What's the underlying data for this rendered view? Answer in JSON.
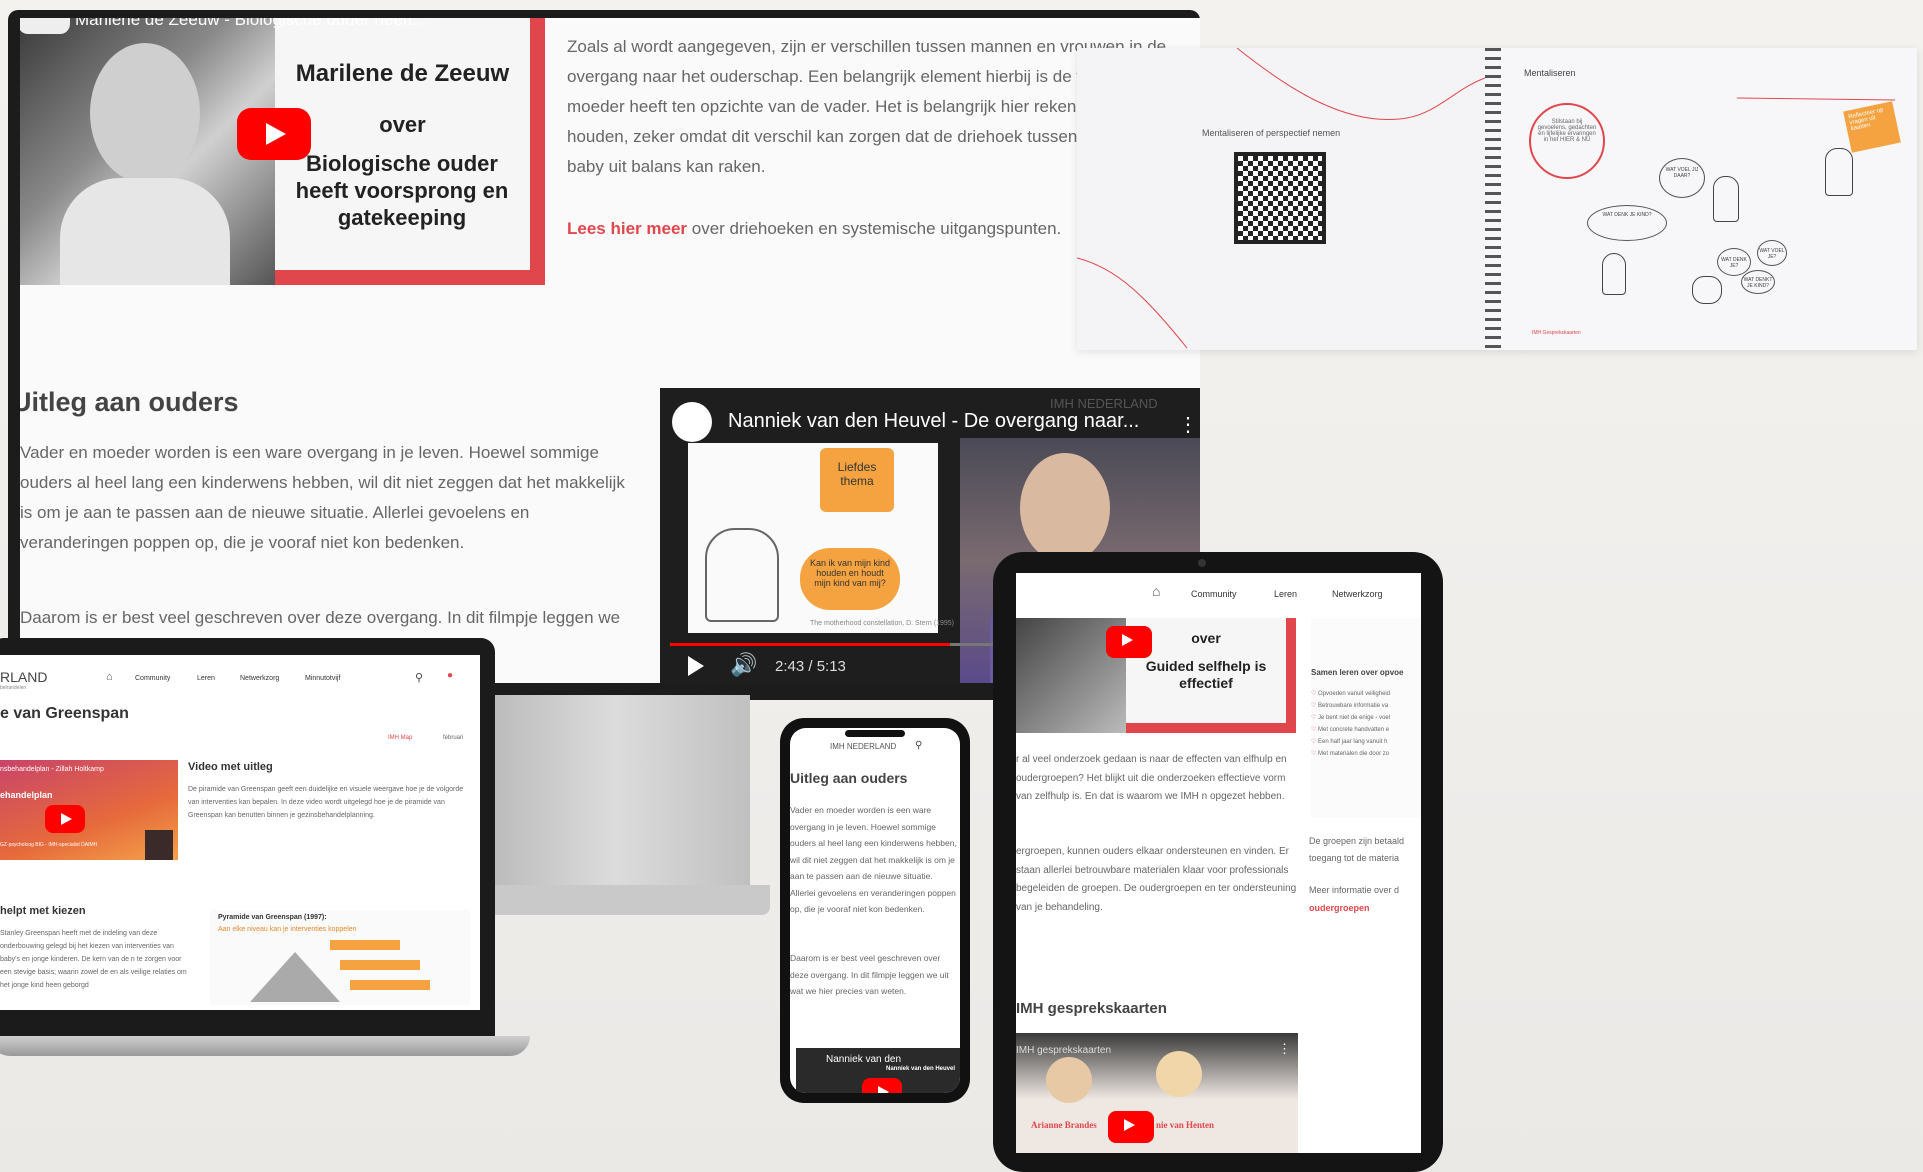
{
  "monitor": {
    "video1": {
      "title_bar": "Marilene de Zeeuw - Biologische ouder heeft...",
      "name": "Marilene de Zeeuw",
      "over": "over",
      "topic": "Biologische ouder heeft voorsprong en gatekeeping"
    },
    "para1": "Zoals al wordt aangegeven, zijn er verschillen tussen mannen en vrouwen in de overgang naar het ouderschap. Een belangrijk element hierbij is de voorsprong die de moeder heeft ten opzichte van de vader. Het is belangrijk hier rekening mee te houden, zeker omdat dit verschil kan zorgen dat de driehoek tussen vader, moeder en baby uit balans kan raken.",
    "link_text": "Lees hier meer",
    "link_rest": "over driehoeken en systemische uitgangspunten.",
    "section_heading": "Uitleg aan ouders",
    "para2": "Vader en moeder worden is een ware overgang in je leven. Hoewel sommige ouders al heel lang een kinderwens hebben, wil dit niet zeggen dat het makkelijk is om je aan te passen aan de nieuwe situatie. Allerlei gevoelens en veranderingen poppen op, die je vooraf niet kon bedenken.",
    "para3": "Daarom is er best veel geschreven over deze overgang. In dit filmpje leggen we uit wat we hier precies van weten.",
    "video2": {
      "title": "Nanniek van den Heuvel - De overgang naar...",
      "brand": "IMH NEDERLAND",
      "bubble1": "Liefdes thema",
      "bubble2": "Kan ik van mijn kind houden en houdt mijn kind van mij?",
      "caption": "The motherhood constellation, D. Stern (1995)",
      "time": "2:43 / 5:13"
    }
  },
  "notebook": {
    "left_label": "Mentaliseren of perspectief nemen",
    "right_label": "Mentaliseren",
    "circle_text": "Stilstaan bij gevoelens, gedachten en lijfelijke ervaringen in het HIER & NU",
    "sticky_text": "Reflecteer op vragen uit kaarten",
    "bubbles": [
      "WAT VOEL JIJ DAAR?",
      "WAT DENK JE KIND?",
      "WAT VOELT JE KIND?",
      "WAT DENK JE?",
      "WAT VOEL JE?",
      "WAT DENKT JE KIND?"
    ],
    "footer": "IMH Gesprekskaarten"
  },
  "laptop": {
    "brand": "RLAND",
    "brand_sub": "behandelen",
    "nav": [
      "Community",
      "Leren",
      "Netwerkzorg",
      "Minnutotvijf"
    ],
    "title": "e van Greenspan",
    "meta1": "IMH Map",
    "meta2": "februari",
    "video_title": "nsbehandelplan - Zillah Holtkamp",
    "video_overlay": "ehandelplan",
    "video_sub": "GZ-psycholoog BIG - IMH-specialist DAIMH",
    "side_heading": "Video met uitleg",
    "side_text": "De piramide van Greenspan geeft een duidelijke en visuele weergave hoe je de volgorde van interventies kan bepalen. In deze video wordt uitgelegd hoe je de piramide van Greenspan kan benutten binnen je gezinsbehandelplanning.",
    "heading2": "helpt met kiezen",
    "text2": "Stanley Greenspan heeft met de indeling van deze onderbouwing gelegd bij het kiezen van interventies van baby's en jonge kinderen. De kern van de n te zorgen voor een stevige basis; waarin zowel de en als veilige relaties om het jonge kind heen geborgd",
    "pyr_title": "Pyramide van Greenspan (1997):",
    "pyr_sub": "Aan elke niveau kan je interventies koppelen"
  },
  "phone": {
    "brand": "IMH NEDERLAND",
    "heading": "Uitleg aan ouders",
    "para1": "Vader en moeder worden is een ware overgang in je leven. Hoewel sommige ouders al heel lang een kinderwens hebben, wil dit niet zeggen dat het makkelijk is om je aan te passen aan de nieuwe situatie. Allerlei gevoelens en veranderingen poppen op, die je vooraf niet kon bedenken.",
    "para2": "Daarom is er best veel geschreven over deze overgang. In dit filmpje leggen we uit wat we hier precies van weten.",
    "video_title": "Nanniek van den",
    "video_name": "Nanniek van den Heuvel"
  },
  "tablet": {
    "nav": [
      "Community",
      "Leren",
      "Netwerkzorg"
    ],
    "video_over": "over",
    "video_topic": "Guided selfhelp is effectief",
    "para1": "r al veel onderzoek gedaan is naar de effecten van elfhulp en oudergroepen? Het blijkt uit die onderzoeken effectieve vorm van zelfhulp is. En dat is waarom we IMH n opgezet hebben.",
    "para2": "ergroepen, kunnen ouders elkaar ondersteunen en vinden. Er staan allerlei betrouwbare materialen klaar voor professionals begeleiden de groepen. De oudergroepen en ter ondersteuning van je behandeling.",
    "side_heading": "Samen leren over opvoe",
    "side_items": [
      "Opvoeden vanuit veiligheid",
      "Betrouwbare informatie va",
      "Je bent niet de enige - voel",
      "Met concrete handvatten e",
      "Een half jaar lang vanuit h",
      "Met materialen die door zo"
    ],
    "side_text1": "De groepen zijn betaald toegang tot de materia",
    "side_text2": "Meer informatie over d",
    "side_link": "oudergroepen",
    "heading": "IMH gesprekskaarten",
    "video_title": "IMH gesprekskaarten",
    "person1": "Arianne Brandes",
    "person2": "nie van Henten"
  },
  "colors": {
    "accent": "#e0474c",
    "youtube": "#ff0000",
    "orange": "#f5a340"
  }
}
